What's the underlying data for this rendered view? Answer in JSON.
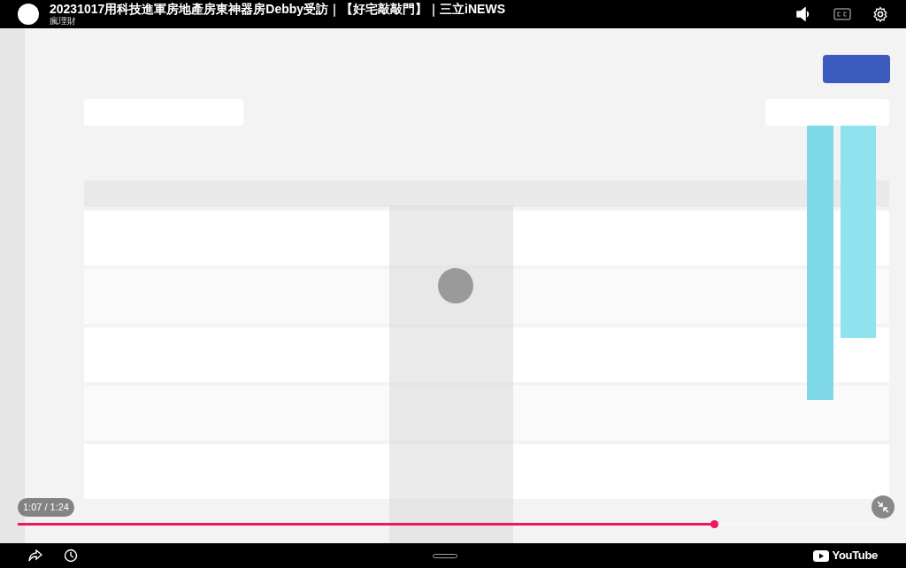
{
  "player": {
    "title": "20231017用科技進軍房地產房東神器房Debby受訪｜【好宅敲敲門】｜三立iNEWS",
    "channel": "瘋理財",
    "time": "1:07 / 1:24",
    "progress": {
      "level": 0.8
    },
    "logo": "YouTube"
  }
}
